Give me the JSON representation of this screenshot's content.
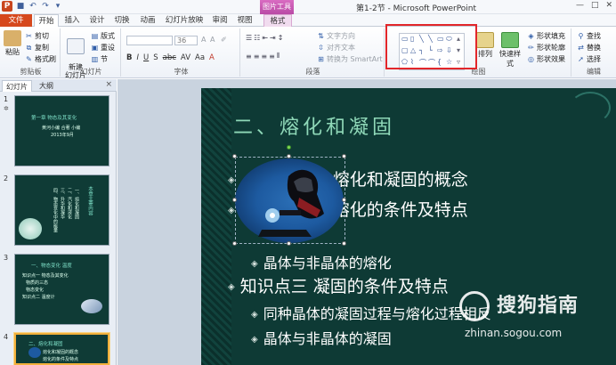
{
  "window": {
    "title": "第1-2节 - Microsoft PowerPoint",
    "context_tab": "图片工具",
    "controls": [
      "—",
      "□",
      "✕"
    ]
  },
  "tabs": [
    "文件",
    "开始",
    "插入",
    "设计",
    "切换",
    "动画",
    "幻灯片放映",
    "审阅",
    "视图",
    "格式"
  ],
  "ribbon": {
    "clipboard": {
      "paste": "粘贴",
      "cut": "剪切",
      "copy": "复制",
      "format_painter": "格式刷",
      "label": "剪贴板"
    },
    "slides": {
      "new_slide": "新建\n幻灯片",
      "layout": "版式",
      "reset": "重设",
      "section": "节",
      "label": "幻灯片"
    },
    "font": {
      "size": "36",
      "label": "字体",
      "buttons": [
        "B",
        "I",
        "U",
        "S",
        "abc",
        "AV",
        "Aa",
        "A"
      ]
    },
    "paragraph": {
      "text_direction": "文字方向",
      "align_text": "对齐文本",
      "smartart": "转换为 SmartArt",
      "label": "段落"
    },
    "drawing": {
      "arrange": "排列",
      "quick_styles": "快速样式",
      "fill": "形状填充",
      "outline": "形状轮廓",
      "effects": "形状效果",
      "label": "绘图"
    },
    "editing": {
      "find": "查找",
      "replace": "替换",
      "select": "选择",
      "label": "编辑"
    }
  },
  "panel": {
    "tabs": [
      "幻灯片",
      "大纲"
    ],
    "close": "×",
    "thumbs": [
      {
        "num": "1",
        "title": "第一章 物态及其变化",
        "sub": "黄河小编 合著 小编",
        "date": "2013年9月"
      },
      {
        "num": "2",
        "title": "本章主要内容",
        "lines": [
          "一、熔化和凝固",
          "二、汽化和液化",
          "三、升华和凝华",
          "四、物态变化中的能量"
        ]
      },
      {
        "num": "3",
        "title": "一、物态变化 温度",
        "lines": [
          "知识点一 物态及其变化",
          "物质的三态",
          "物态变化",
          "知识点二 温度计"
        ]
      },
      {
        "num": "4",
        "title": "二、熔化和凝固",
        "lines": [
          "熔化和凝固的概念",
          "熔化的条件及特点"
        ]
      }
    ]
  },
  "slide": {
    "title": "二、熔化和凝固",
    "bullets": [
      {
        "text": "熔化和凝固的概念",
        "level": 1
      },
      {
        "text": "熔化的条件及特点",
        "level": 1
      },
      {
        "text": "晶体与非晶体的熔化",
        "level": 2
      },
      {
        "text": "知识点三  凝固的条件及特点",
        "level": 1
      },
      {
        "text": "同种晶体的凝固过程与熔化过程相反",
        "level": 2
      },
      {
        "text": "晶体与非晶体的凝固",
        "level": 2
      }
    ]
  },
  "watermark": {
    "brand": "搜狗指南",
    "url": "zhinan.sogou.com"
  },
  "colors": {
    "file_tab": "#d6481d",
    "context_tab": "#c95ab5",
    "slide_bg": "#0e3a35",
    "highlight_box": "#e2262a"
  }
}
